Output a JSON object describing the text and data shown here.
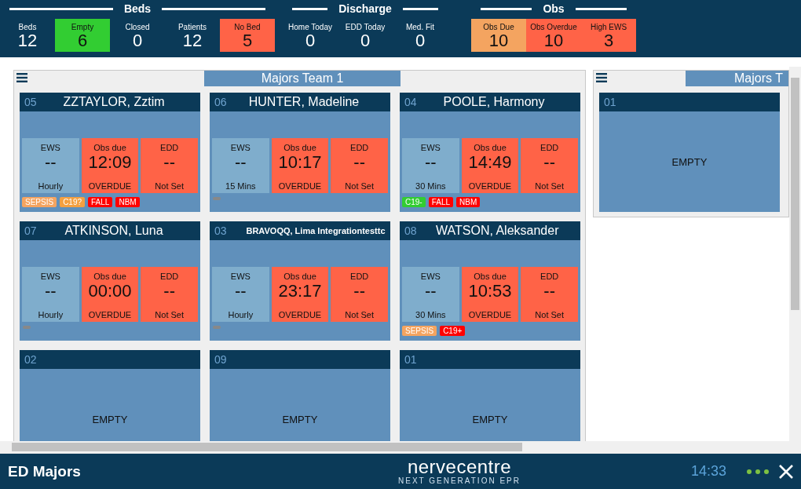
{
  "summary": {
    "groups": [
      {
        "title": "Beds",
        "items": [
          {
            "label": "Beds",
            "value": "12"
          },
          {
            "label": "Empty",
            "value": "6",
            "color": "#32cd32"
          },
          {
            "label": "Closed",
            "value": "0"
          },
          {
            "label": "Patients",
            "value": "12"
          },
          {
            "label": "No Bed",
            "value": "5",
            "color": "#ff6347"
          }
        ]
      },
      {
        "title": "Discharge",
        "items": [
          {
            "label": "Home Today",
            "value": "0"
          },
          {
            "label": "EDD Today",
            "value": "0"
          },
          {
            "label": "Med. Fit",
            "value": "0"
          }
        ]
      },
      {
        "title": "Obs",
        "items": [
          {
            "label": "Obs Due",
            "value": "10",
            "color": "#f4a460"
          },
          {
            "label": "Obs Overdue",
            "value": "10",
            "color": "#ff6347"
          },
          {
            "label": "High EWS",
            "value": "3",
            "color": "#ff6347"
          }
        ]
      }
    ]
  },
  "panels": [
    {
      "title": "Majors Team 1",
      "beds": [
        {
          "kind": "patient",
          "bed": "05",
          "name": "ZZTAYLOR, Zztim",
          "stats": [
            {
              "kind": "ews",
              "label": "EWS",
              "value": "--",
              "sub": "Hourly"
            },
            {
              "kind": "alert",
              "label": "Obs due",
              "value": "12:09",
              "sub": "OVERDUE"
            },
            {
              "kind": "alert",
              "label": "EDD",
              "value": "--",
              "sub": "Not Set"
            }
          ],
          "tags": [
            {
              "label": "SEPSIS",
              "color": "#f4a460"
            },
            {
              "label": "C19?",
              "color": "#f4a040"
            },
            {
              "label": "FALL",
              "color": "#ff0000"
            },
            {
              "label": "NBM",
              "color": "#ff0000"
            }
          ]
        },
        {
          "kind": "patient",
          "bed": "06",
          "name": "HUNTER, Madeline",
          "stats": [
            {
              "kind": "ews",
              "label": "EWS",
              "value": "--",
              "sub": "15 Mins"
            },
            {
              "kind": "alert",
              "label": "Obs due",
              "value": "10:17",
              "sub": "OVERDUE"
            },
            {
              "kind": "alert",
              "label": "EDD",
              "value": "--",
              "sub": "Not Set"
            }
          ]
        },
        {
          "kind": "patient",
          "bed": "04",
          "name": "POOLE, Harmony",
          "stats": [
            {
              "kind": "ews",
              "label": "EWS",
              "value": "--",
              "sub": "30 Mins"
            },
            {
              "kind": "alert",
              "label": "Obs due",
              "value": "14:49",
              "sub": "OVERDUE"
            },
            {
              "kind": "alert",
              "label": "EDD",
              "value": "--",
              "sub": "Not Set"
            }
          ],
          "tags": [
            {
              "label": "C19-",
              "color": "#32cd32"
            },
            {
              "label": "FALL",
              "color": "#ff0000"
            },
            {
              "label": "NBM",
              "color": "#ff0000"
            }
          ]
        },
        {
          "kind": "patient",
          "bed": "07",
          "name": "ATKINSON, Luna",
          "stats": [
            {
              "kind": "ews",
              "label": "EWS",
              "value": "--",
              "sub": "Hourly"
            },
            {
              "kind": "alert",
              "label": "Obs due",
              "value": "00:00",
              "sub": "OVERDUE"
            },
            {
              "kind": "alert",
              "label": "EDD",
              "value": "--",
              "sub": "Not Set"
            }
          ]
        },
        {
          "kind": "patient",
          "bed": "03",
          "name": "BRAVOQQ, Lima Integrationtesttc",
          "stats": [
            {
              "kind": "ews",
              "label": "EWS",
              "value": "--",
              "sub": "Hourly"
            },
            {
              "kind": "alert",
              "label": "Obs due",
              "value": "23:17",
              "sub": "OVERDUE"
            },
            {
              "kind": "alert",
              "label": "EDD",
              "value": "--",
              "sub": "Not Set"
            }
          ]
        },
        {
          "kind": "patient",
          "bed": "08",
          "name": "WATSON, Aleksander",
          "stats": [
            {
              "kind": "ews",
              "label": "EWS",
              "value": "--",
              "sub": "30 Mins"
            },
            {
              "kind": "alert",
              "label": "Obs due",
              "value": "10:53",
              "sub": "OVERDUE"
            },
            {
              "kind": "alert",
              "label": "EDD",
              "value": "--",
              "sub": "Not Set"
            }
          ],
          "tags": [
            {
              "label": "SEPSIS",
              "color": "#f4a460"
            },
            {
              "label": "C19+",
              "color": "#ff0000"
            }
          ]
        },
        {
          "kind": "empty",
          "bed": "02",
          "text": "EMPTY"
        },
        {
          "kind": "empty",
          "bed": "09",
          "text": "EMPTY"
        },
        {
          "kind": "empty",
          "bed": "01",
          "text": "EMPTY"
        }
      ]
    },
    {
      "title": "Majors T",
      "beds": [
        {
          "kind": "empty",
          "bed": "01",
          "text": "EMPTY"
        }
      ]
    }
  ],
  "footer": {
    "title": "ED Majors",
    "logo": "nervecentre",
    "tagline": "NEXT GENERATION EPR",
    "time": "14:33"
  }
}
